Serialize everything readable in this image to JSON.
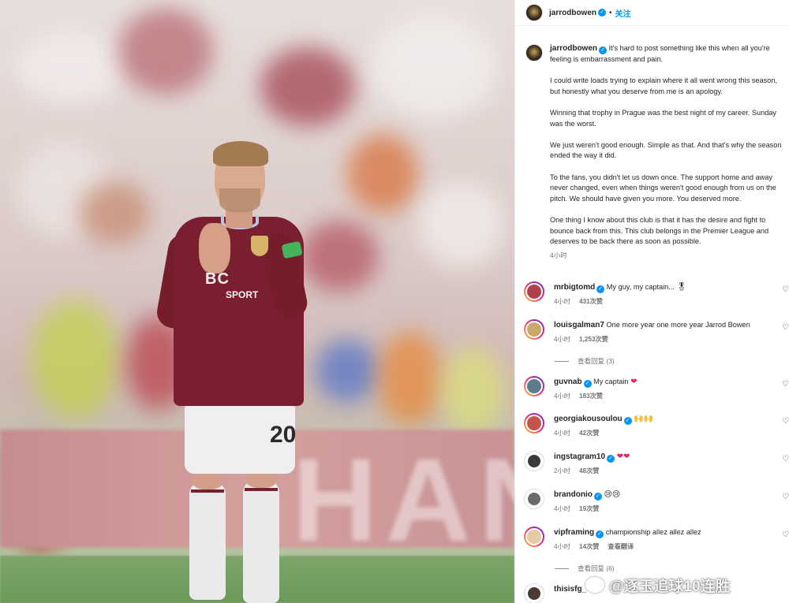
{
  "post": {
    "author": "jarrodbowen",
    "follow_label": "关注",
    "separator": "•",
    "caption": {
      "first": "It's hard to post something like this when all you're feeling is embarrassment and pain.",
      "paragraphs": [
        "I could write loads trying to explain where it all went wrong this season, but honestly what you deserve from me is an apology.",
        "Winning that trophy in Prague was the best night of my career. Sunday was the worst.",
        "We just weren't good enough. Simple as that. And that's why the season ended the way it did.",
        "To the fans, you didn't let us down once. The support home and away never changed, even when things weren't good enough from us on the pitch. We should have given you more. You deserved more.",
        "One thing I know about this club is that it has the desire and fight to bounce back from this. This club belongs in the Premier League and deserves to be back there as soon as possible."
      ],
      "time": "4小时"
    },
    "photo": {
      "shirt_sponsor": "BC",
      "shirt_sponsor_sub": "SPORT",
      "shorts_number": "20",
      "board_text": "HAN"
    }
  },
  "comments": [
    {
      "user": "mrbigtomd",
      "verified": true,
      "text": "My guy, my captain...",
      "emoji": "🎖",
      "time": "4小时",
      "likes": "431次赞",
      "translate": "",
      "ring": true
    },
    {
      "user": "louisgalman7",
      "verified": false,
      "text": "One more year one more year Jarrod Bowen",
      "emoji": "",
      "time": "4小时",
      "likes": "1,253次赞",
      "translate": "",
      "ring": true
    },
    {
      "user": "guvnab",
      "verified": true,
      "text": "My captain",
      "emoji": "❤",
      "time": "4小时",
      "likes": "183次赞",
      "translate": "",
      "ring": true
    },
    {
      "user": "georgiakousoulou",
      "verified": true,
      "text": "",
      "emoji": "🙌🙌",
      "time": "4小时",
      "likes": "42次赞",
      "translate": "",
      "ring": true
    },
    {
      "user": "ingstagram10",
      "verified": true,
      "text": "",
      "emoji": "❤❤",
      "time": "2小时",
      "likes": "48次赞",
      "translate": "",
      "ring": false
    },
    {
      "user": "brandonio",
      "verified": true,
      "text": "",
      "emoji": "😢😢",
      "time": "4小时",
      "likes": "19次赞",
      "translate": "",
      "ring": false
    },
    {
      "user": "vipframing",
      "verified": true,
      "text": "championship allez allez allez",
      "emoji": "",
      "time": "4小时",
      "likes": "14次赞",
      "translate": "查看翻译",
      "ring": true
    }
  ],
  "replies": [
    {
      "label": "查看回复 (3)"
    },
    {
      "label": "查看回复 (6)"
    }
  ],
  "last_comment": {
    "user": "thisisfg_"
  },
  "watermark": {
    "text": "@逐玉追球10连胜"
  },
  "colors": {
    "link": "#0095f6",
    "muted": "#737373",
    "shirt": "#7a1f2f"
  }
}
